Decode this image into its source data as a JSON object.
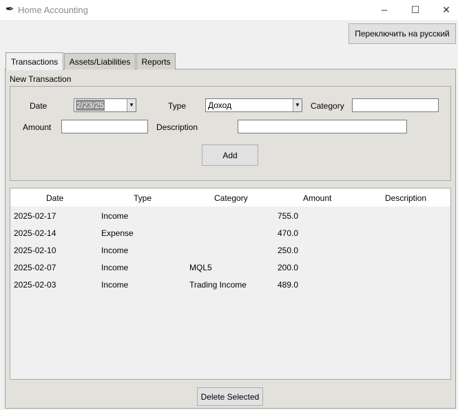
{
  "window": {
    "title": "Home Accounting",
    "minimize": "–",
    "maximize": "☐",
    "close": "✕"
  },
  "header": {
    "lang_button": "Переключить на русский"
  },
  "tabs": [
    {
      "label": "Transactions"
    },
    {
      "label": "Assets/Liabilities"
    },
    {
      "label": "Reports"
    }
  ],
  "form": {
    "section_title": "New Transaction",
    "date_label": "Date",
    "date_value": "2/23/25",
    "type_label": "Type",
    "type_value": "Доход",
    "category_label": "Category",
    "category_value": "",
    "amount_label": "Amount",
    "amount_value": "",
    "description_label": "Description",
    "description_value": "",
    "add_button": "Add"
  },
  "table": {
    "columns": [
      "Date",
      "Type",
      "Category",
      "Amount",
      "Description"
    ],
    "rows": [
      {
        "date": "2025-02-17",
        "type": "Income",
        "category": "",
        "amount": "755.0",
        "description": ""
      },
      {
        "date": "2025-02-14",
        "type": "Expense",
        "category": "",
        "amount": "470.0",
        "description": ""
      },
      {
        "date": "2025-02-10",
        "type": "Income",
        "category": "",
        "amount": "250.0",
        "description": ""
      },
      {
        "date": "2025-02-07",
        "type": "Income",
        "category": "MQL5",
        "amount": "200.0",
        "description": ""
      },
      {
        "date": "2025-02-03",
        "type": "Income",
        "category": "Trading Income",
        "amount": "489.0",
        "description": ""
      }
    ]
  },
  "footer": {
    "delete_button": "Delete Selected"
  }
}
